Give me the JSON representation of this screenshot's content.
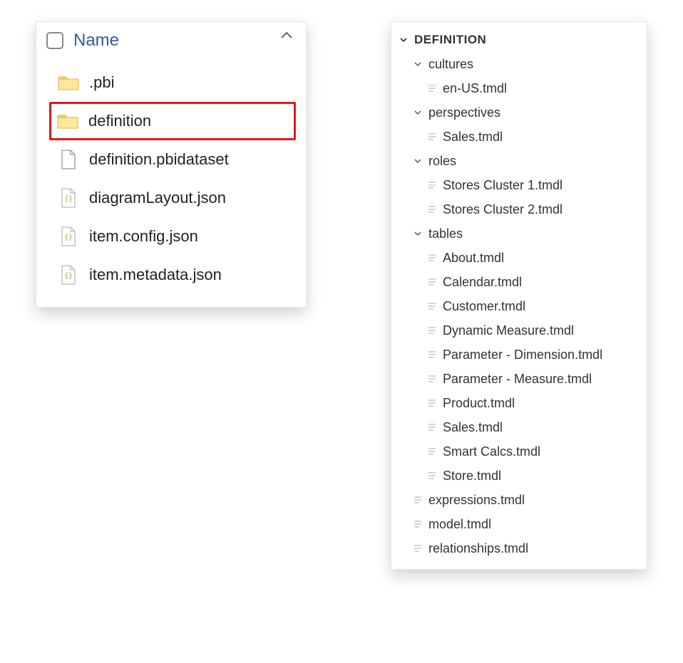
{
  "leftPanel": {
    "columnHeader": "Name",
    "items": [
      {
        "label": ".pbi",
        "icon": "folder"
      },
      {
        "label": "definition",
        "icon": "folder",
        "highlight": true
      },
      {
        "label": "definition.pbidataset",
        "icon": "blankfile"
      },
      {
        "label": "diagramLayout.json",
        "icon": "jsonfile"
      },
      {
        "label": "item.config.json",
        "icon": "jsonfile"
      },
      {
        "label": "item.metadata.json",
        "icon": "jsonfile"
      }
    ]
  },
  "rightPanel": {
    "rootLabel": "DEFINITION",
    "groups": [
      {
        "label": "cultures",
        "files": [
          "en-US.tmdl"
        ]
      },
      {
        "label": "perspectives",
        "files": [
          "Sales.tmdl"
        ]
      },
      {
        "label": "roles",
        "files": [
          "Stores Cluster 1.tmdl",
          "Stores Cluster 2.tmdl"
        ]
      },
      {
        "label": "tables",
        "files": [
          "About.tmdl",
          "Calendar.tmdl",
          "Customer.tmdl",
          "Dynamic Measure.tmdl",
          "Parameter - Dimension.tmdl",
          "Parameter - Measure.tmdl",
          "Product.tmdl",
          "Sales.tmdl",
          "Smart Calcs.tmdl",
          "Store.tmdl"
        ]
      }
    ],
    "rootFiles": [
      "expressions.tmdl",
      "model.tmdl",
      "relationships.tmdl"
    ]
  }
}
